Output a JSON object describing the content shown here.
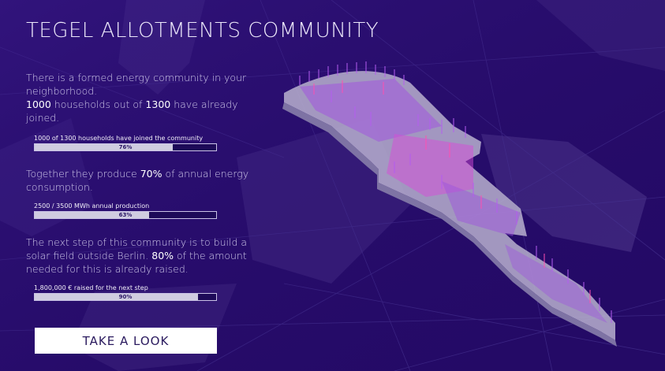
{
  "header": {
    "title": "TEGEL ALLOTMENTS COMMUNITY"
  },
  "intro": {
    "line1": "There is a formed energy community in your neighborhood.",
    "joined_count": "1000",
    "mid": " households out of ",
    "total_count": "1300",
    "end": " have already joined."
  },
  "bar_households": {
    "label": "1000 of 1300 households have joined the community",
    "percent_text": "76%",
    "fraction": 0.76
  },
  "production": {
    "before": "Together they produce ",
    "percent": "70%",
    "after": " of annual energy consumption."
  },
  "bar_production": {
    "label": "2500 / 3500 MWh annual production",
    "percent_text": "63%",
    "fraction": 0.63
  },
  "next_step": {
    "before": "The next step of this community is to build a solar field outside Berlin. ",
    "percent": "80%",
    "after": " of the amount needed for this is already raised."
  },
  "bar_funding": {
    "label": "1,800,000 € raised for the next step",
    "percent_text": "90%",
    "fraction": 0.9
  },
  "cta": {
    "label": "TAKE A LOOK"
  },
  "colors": {
    "background": "#240a66",
    "accent": "#c04de0",
    "bar_fill": "#cfcce0"
  },
  "icons": {
    "map": "city-map-3d-visualization"
  }
}
